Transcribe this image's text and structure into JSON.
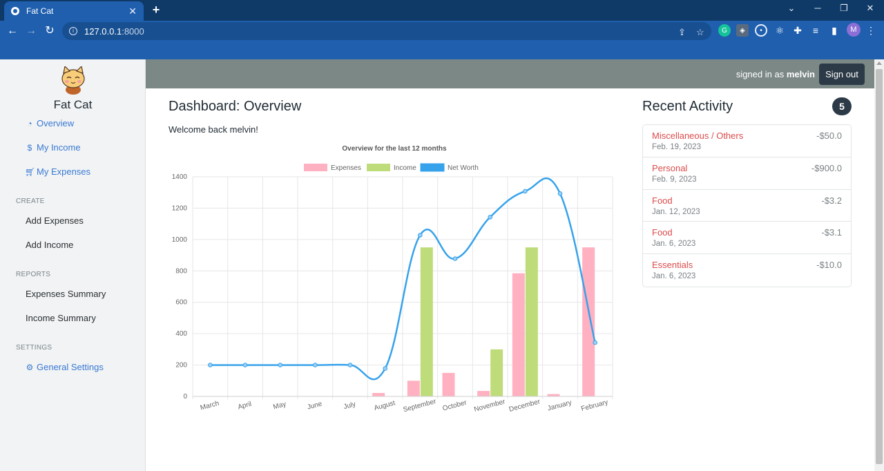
{
  "browser": {
    "tab_title": "Fat Cat",
    "tab_close": "✕",
    "new_tab": "+",
    "url_host": "127.0.0.1",
    "url_port": ":8000",
    "profile_initial": "M",
    "icons": [
      "back-arrow-icon",
      "forward-arrow-icon",
      "reload-icon",
      "info-icon",
      "share-icon",
      "star-icon",
      "grammarly-icon",
      "shield-icon",
      "target-icon",
      "react-icon",
      "puzzle-icon",
      "playlist-icon",
      "sidepanel-icon",
      "more-vert-icon"
    ]
  },
  "sidebar": {
    "brand": "Fat Cat",
    "nav": [
      {
        "label": "Overview",
        "icon": "dashboard-icon"
      },
      {
        "label": "My Income",
        "icon": "coins-icon"
      },
      {
        "label": "My Expenses",
        "icon": "cart-icon"
      }
    ],
    "sections": {
      "create": "CREATE",
      "reports": "REPORTS",
      "settings": "SETTINGS"
    },
    "create_links": [
      "Add Expenses",
      "Add Income"
    ],
    "report_links": [
      "Expenses Summary",
      "Income Summary"
    ],
    "settings_link": {
      "label": "General Settings",
      "icon": "gear-icon"
    }
  },
  "header": {
    "signed_prefix": "signed in as ",
    "username": "melvin",
    "signout_label": "Sign out"
  },
  "main": {
    "title": "Dashboard: Overview",
    "welcome": "Welcome back melvin!"
  },
  "recent": {
    "title": "Recent Activity",
    "count": "5",
    "items": [
      {
        "category": "Miscellaneous / Others",
        "date": "Feb. 19, 2023",
        "amount": "-$50.0"
      },
      {
        "category": "Personal",
        "date": "Feb. 9, 2023",
        "amount": "-$900.0"
      },
      {
        "category": "Food",
        "date": "Jan. 12, 2023",
        "amount": "-$3.2"
      },
      {
        "category": "Food",
        "date": "Jan. 6, 2023",
        "amount": "-$3.1"
      },
      {
        "category": "Essentials",
        "date": "Jan. 6, 2023",
        "amount": "-$10.0"
      }
    ]
  },
  "colors": {
    "expenses": "#ffb1c1",
    "income": "#bfdc7b",
    "net_worth": "#36a2eb",
    "activity_category": "#dc4b4b"
  },
  "chart_data": {
    "type": "bar",
    "title": "Overview for the last 12 months",
    "categories": [
      "March",
      "April",
      "May",
      "June",
      "July",
      "August",
      "September",
      "October",
      "November",
      "December",
      "January",
      "February"
    ],
    "series": [
      {
        "name": "Expenses",
        "type": "bar",
        "values": [
          0,
          0,
          0,
          0,
          0,
          22,
          100,
          150,
          35,
          785,
          15,
          950
        ]
      },
      {
        "name": "Income",
        "type": "bar",
        "values": [
          0,
          0,
          0,
          0,
          0,
          0,
          950,
          0,
          300,
          950,
          0,
          0
        ]
      },
      {
        "name": "Net Worth",
        "type": "line",
        "values": [
          200,
          200,
          200,
          200,
          200,
          178,
          1028,
          878,
          1143,
          1308,
          1293,
          343
        ]
      }
    ],
    "ylim": [
      0,
      1400
    ],
    "yticks": [
      0,
      200,
      400,
      600,
      800,
      1000,
      1200,
      1400
    ],
    "legend": "top",
    "grid": true
  }
}
